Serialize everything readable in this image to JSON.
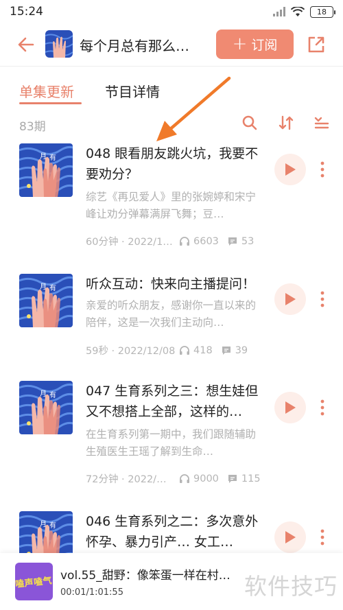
{
  "status_bar": {
    "time": "15:24",
    "battery": "18"
  },
  "header": {
    "podcast_title": "每个月总有那么…",
    "subscribe_label": "订阅",
    "subscribe_plus": "+"
  },
  "tabs": [
    {
      "label": "单集更新",
      "active": true
    },
    {
      "label": "节目详情",
      "active": false
    }
  ],
  "episode_count": "83期",
  "episodes": [
    {
      "title": "048 眼看朋友跳火坑，我要不要劝分？",
      "description": "综艺《再见爱人》里的张婉婷和宋宁峰让劝分弹幕满屏飞舞；豆…",
      "duration_date": "60分钟 · 2022/1…",
      "plays": "6603",
      "comments": "53"
    },
    {
      "title": "听众互动：快来向主播提问！",
      "description": "亲爱的听众朋友，感谢你一直以来的陪伴，这是一次我们主动向…",
      "duration_date": "59秒 · 2022/12/08",
      "plays": "418",
      "comments": "39"
    },
    {
      "title": "047 生育系列之三：想生娃但又不想搭上全部，这样的…",
      "description": "在生育系列第一期中，我们跟随辅助生殖医生王瑶了解到生命…",
      "duration_date": "72分钟 · 2022/…",
      "plays": "9000",
      "comments": "115"
    },
    {
      "title": "046 生育系列之二：多次意外怀孕、暴力引产… 女工…",
      "description": "",
      "duration_date": "",
      "plays": "",
      "comments": ""
    }
  ],
  "mini_player": {
    "title": "vol.55_甜野：像笨蛋一样在村…",
    "time": "00:01/1:01:55",
    "cover_text": "嗑声嗑气"
  },
  "watermark": "软件技巧",
  "colors": {
    "accent": "#e8826b",
    "button": "#f08a72",
    "arrow": "#f07a2a"
  }
}
